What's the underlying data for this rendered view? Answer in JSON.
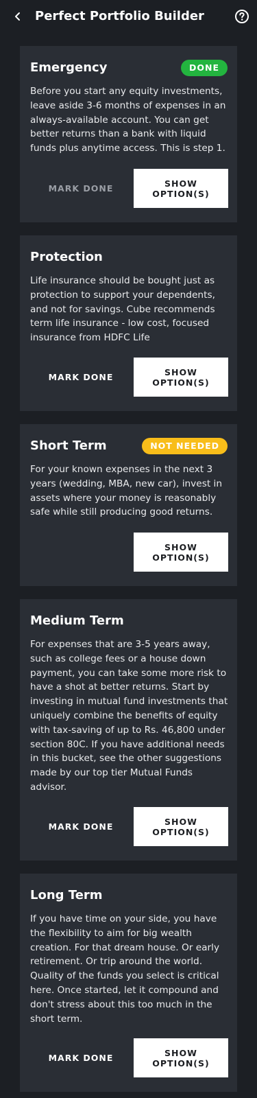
{
  "header": {
    "title": "Perfect Portfolio Builder",
    "back_icon": "back-chevron-icon",
    "help_icon": "help-circle-icon"
  },
  "colors": {
    "background": "#1c1f24",
    "card": "#2a2e35",
    "done_badge": "#23b43f",
    "not_needed_badge": "#f8bd1a",
    "button_primary": "#ffffff",
    "muted_text": "#9a9ea5"
  },
  "cards": [
    {
      "title": "Emergency",
      "badge": "DONE",
      "text": "Before you start any equity investments, leave aside 3-6 months of expenses in an always-available account. You can get better returns than a bank with liquid funds plus anytime access. This is step 1.",
      "mark_done_label": "MARK DONE",
      "show_options_label": "SHOW OPTION(S)"
    },
    {
      "title": "Protection",
      "text": "Life insurance should be bought just as protection to support your dependents, and not for savings. Cube recommends term life insurance - low cost, focused insurance from HDFC Life",
      "mark_done_label": "MARK DONE",
      "show_options_label": "SHOW OPTION(S)"
    },
    {
      "title": "Short Term",
      "badge": "NOT NEEDED",
      "text": "For your known expenses in the next 3 years (wedding, MBA, new car), invest in assets where your money is reasonably safe while still producing good returns.",
      "show_options_label": "SHOW OPTION(S)"
    },
    {
      "title": "Medium Term",
      "text": "For expenses that are 3-5 years away, such as college fees or a house down payment, you can take some more risk to have a shot at better returns. Start by investing in mutual fund investments that uniquely combine the benefits of equity with tax-saving of up to Rs. 46,800 under section 80C. If you have additional needs in this bucket, see the other suggestions made by our top tier Mutual Funds advisor.",
      "mark_done_label": "MARK DONE",
      "show_options_label": "SHOW OPTION(S)"
    },
    {
      "title": "Long Term",
      "text": "If you have time on your side, you have the flexibility to aim for big wealth creation. For that dream house. Or early retirement. Or trip around the world. Quality of the funds you select is critical here. Once started, let it compound and don't stress about this too much in the short term.",
      "mark_done_label": "MARK DONE",
      "show_options_label": "SHOW OPTION(S)"
    }
  ]
}
